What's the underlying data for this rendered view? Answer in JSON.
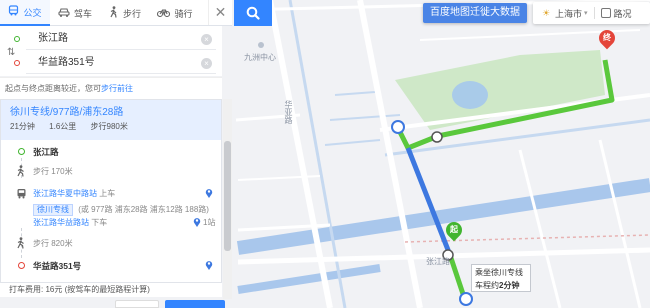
{
  "modes": [
    {
      "label": "公交",
      "icon": "bus-icon"
    },
    {
      "label": "驾车",
      "icon": "car-icon"
    },
    {
      "label": "步行",
      "icon": "walk-icon"
    },
    {
      "label": "骑行",
      "icon": "bike-icon"
    }
  ],
  "active_mode": "公交",
  "route_inputs": {
    "start": "张江路",
    "end": "华益路351号"
  },
  "notice": {
    "text": "起点与终点距离较近，您可",
    "link": "步行前往"
  },
  "plan": {
    "title": "徐川专线/977路/浦东28路",
    "time": "21分钟",
    "distance": "1.6公里",
    "walk": "步行980米"
  },
  "steps": {
    "start_name": "张江路",
    "walk1": "步行 170米",
    "board_stop": "张江路华夏中路站",
    "board_action": "上车",
    "line_name": "徐川专线",
    "alt_lines": "(或 977路 浦东28路 浦东12路 188路)",
    "alight_stop": "张江路华益路站",
    "alight_action": "下车",
    "stop_count": "1站",
    "walk2": "步行 820米",
    "end_name": "华益路351号"
  },
  "fare": "打车费用: 16元 (按驾车的最短路程计算)",
  "map": {
    "promo": "百度地图迁徙大数据",
    "city": "上海市",
    "road_toggle": "路况",
    "labels": {
      "area1": "九洲中心",
      "road1": "华亚路",
      "poi_bottom": "张江路",
      "end_pin": "终",
      "start_pin": "起"
    },
    "callout_prefix": "乘坐徐川专线",
    "callout_mid": "车程约",
    "callout_num": "2分钟"
  },
  "colors": {
    "accent": "#3385ff",
    "route_walk": "#5ac83c",
    "route_bus": "#3d78e0",
    "end_pin": "#e4453a",
    "start_pin": "#41b530"
  }
}
